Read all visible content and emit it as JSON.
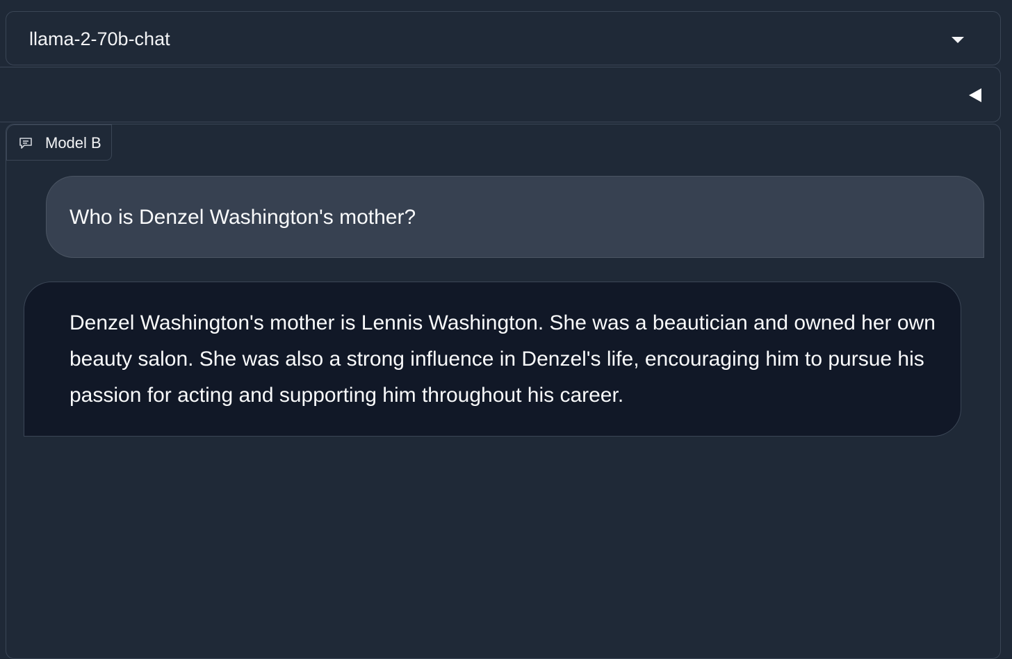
{
  "model_selector": {
    "selected": "llama-2-70b-chat",
    "chevron_icon": "chevron-down-icon"
  },
  "collapsed_panel": {
    "toggle_icon": "triangle-left-icon"
  },
  "chatbot": {
    "label": "Model B",
    "label_icon": "chat-bubble-icon",
    "messages": [
      {
        "role": "user",
        "text": "Who is Denzel Washington's mother?"
      },
      {
        "role": "bot",
        "text": "Denzel Washington's mother is Lennis Washington. She was a beautician and owned her own beauty salon. She was also a strong influence in Denzel's life, encouraging him to pursue his passion for acting and supporting him throughout his career."
      }
    ]
  },
  "colors": {
    "background": "#1f2937",
    "border": "#3b4656",
    "user_bubble": "#374151",
    "bot_bubble": "#111827",
    "text": "#f3f4f6"
  }
}
